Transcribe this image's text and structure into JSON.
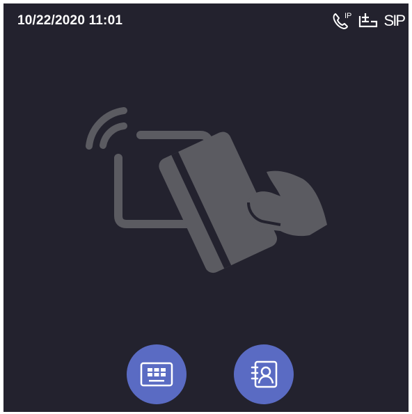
{
  "status_bar": {
    "datetime": "10/22/2020 11:01",
    "icons": [
      "ip-phone-icon",
      "network-icon"
    ],
    "sip_label": "SIP"
  },
  "main": {
    "illustration": "card-swipe-reader-icon"
  },
  "actions": [
    {
      "name": "keypad-button",
      "icon": "keypad-icon"
    },
    {
      "name": "contacts-button",
      "icon": "contacts-icon"
    }
  ],
  "colors": {
    "background": "#23222e",
    "illustration": "#5b5b61",
    "button": "#5a6bc3",
    "text": "#ffffff"
  }
}
